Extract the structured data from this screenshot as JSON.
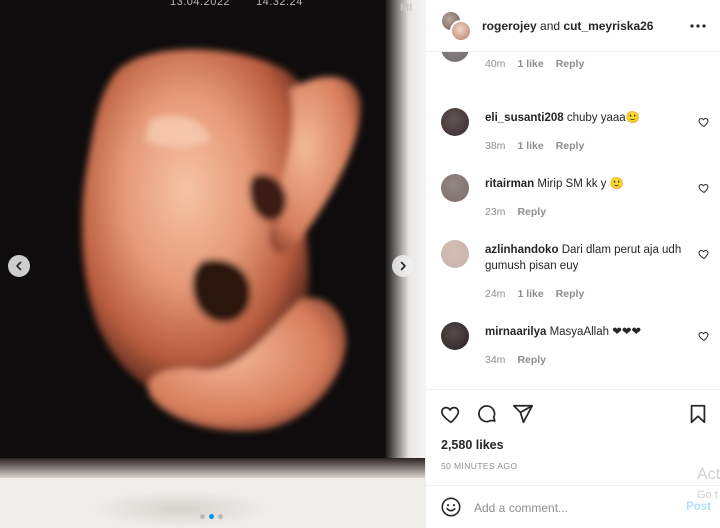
{
  "media": {
    "overlay_date": "13.04.2022",
    "overlay_time": "14:32:24",
    "overlay_tag": "MI",
    "carousel": {
      "slide_count": 3,
      "active_index": 1
    },
    "prev_icon": "chevron-left-icon",
    "next_icon": "chevron-right-icon"
  },
  "header": {
    "user1": "rogerojey",
    "joiner": "and",
    "user2": "cut_meyriska26",
    "more_icon": "more-horizontal-icon"
  },
  "comments": [
    {
      "user": "",
      "text": "",
      "time": "40m",
      "likes": "1 like",
      "reply": "Reply",
      "avatar_color": "#6f6a6a"
    },
    {
      "user": "eli_susanti208",
      "text": "chuby yaaa🙂",
      "time": "38m",
      "likes": "1 like",
      "reply": "Reply",
      "avatar_color": "#3a2b2b"
    },
    {
      "user": "ritairman",
      "text": "Mirip SM kk y 🙂",
      "time": "23m",
      "likes": "",
      "reply": "Reply",
      "avatar_color": "#7a6b66"
    },
    {
      "user": "azlinhandoko",
      "text": "Dari dlam perut aja udh gumush pisan euy",
      "time": "24m",
      "likes": "1 like",
      "reply": "Reply",
      "avatar_color": "#c9b0a5"
    },
    {
      "user": "mirnaarilya",
      "text": "MasyaAllah ❤❤❤",
      "time": "34m",
      "likes": "",
      "reply": "Reply",
      "avatar_color": "#2b2020"
    }
  ],
  "actions": {
    "like_icon": "heart-icon",
    "comment_icon": "comment-icon",
    "share_icon": "paper-plane-icon",
    "save_icon": "bookmark-icon",
    "likes_text": "2,580 likes",
    "time_ago": "50 MINUTES AGO"
  },
  "add_comment": {
    "emoji_icon": "emoji-smile-icon",
    "placeholder": "Add a comment...",
    "post_label": "Post",
    "post_color": "#b2dffc"
  },
  "watermark": {
    "line1": "Act",
    "line2": "Go t"
  },
  "colors": {
    "text": "#262626",
    "muted": "#8e8e8e",
    "accent": "#0095f6",
    "border": "#efefef"
  }
}
